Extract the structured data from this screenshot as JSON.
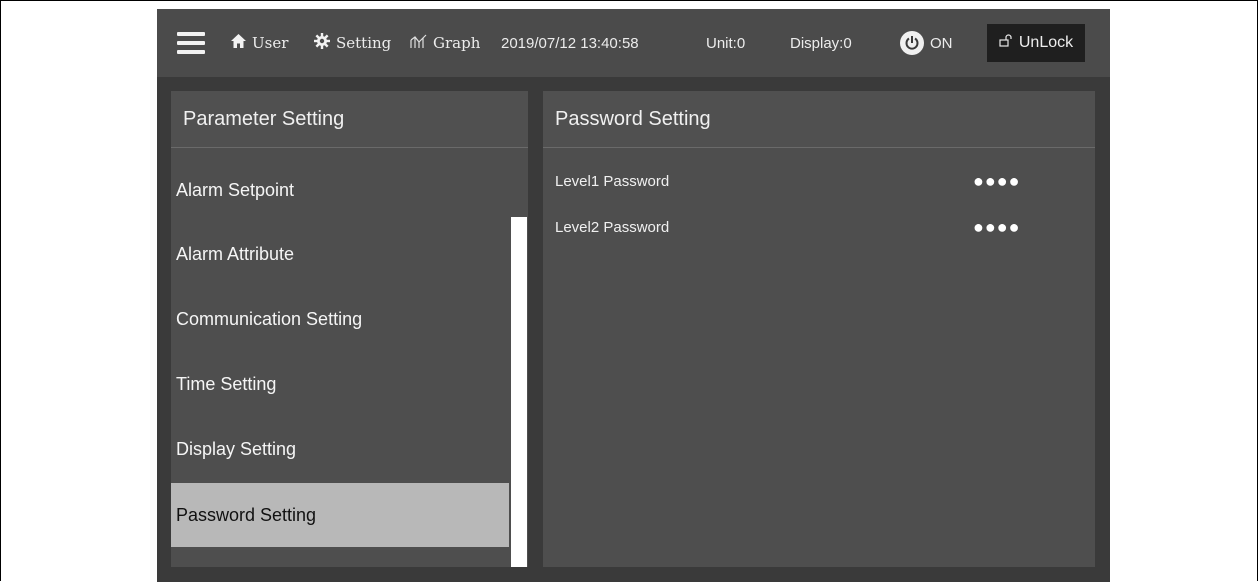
{
  "topbar": {
    "user_label": "User",
    "setting_label": "Setting",
    "graph_label": "Graph",
    "datetime": "2019/07/12 13:40:58",
    "unit": "Unit:0",
    "display": "Display:0",
    "power_label": "ON",
    "unlock_label": "UnLock"
  },
  "left_panel": {
    "title": "Parameter Setting",
    "items": [
      {
        "label": "Alarm Setpoint"
      },
      {
        "label": "Alarm Attribute"
      },
      {
        "label": "Communication Setting"
      },
      {
        "label": "Time Setting"
      },
      {
        "label": "Display Setting"
      },
      {
        "label": "Password Setting"
      }
    ],
    "selected": "Password Setting"
  },
  "right_panel": {
    "title": "Password Setting",
    "rows": [
      {
        "label": "Level1 Password",
        "value": "●●●●"
      },
      {
        "label": "Level2 Password",
        "value": "●●●●"
      }
    ]
  },
  "icons": [
    "menu-icon",
    "home-icon",
    "gear-icon",
    "graph-icon",
    "power-icon",
    "unlock-icon"
  ],
  "colors": {
    "selected_bg": "#b8b8b8",
    "panel_bg": "#4e4e4e",
    "topbar_bg": "#4b4b4b"
  }
}
